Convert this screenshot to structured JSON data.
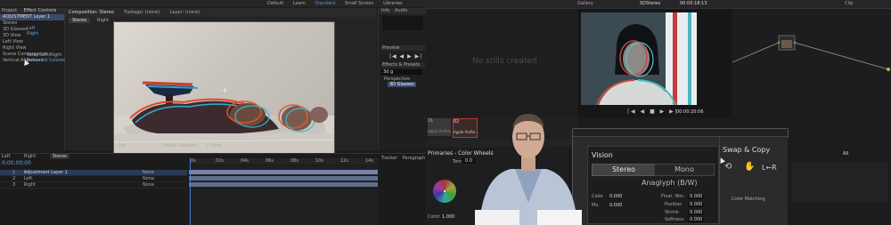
{
  "ae": {
    "menu": [
      "Default",
      "Learn",
      "Standard",
      "Small Screen",
      "Libraries"
    ],
    "project_tabs": [
      "Project",
      "Effect Controls"
    ],
    "project_items": [
      "ADJUSTMENT Layer 1",
      "Stereo",
      "Left",
      "Right",
      "Swap Left/Right",
      "3D View"
    ],
    "effect_items": [
      "3D Glasses",
      "3D View",
      "Left View",
      "Right View",
      "Scene Convergence",
      "Vertical Alignment"
    ],
    "effect_values": [
      "Left",
      "Right",
      "Swap Left/Right",
      "Balanced Colored R..."
    ],
    "viewer_tabs": [
      "Composition: Stereo",
      "Footage: (none)",
      "Layer: (none)"
    ],
    "viewer_subtabs": [
      "Stereo",
      "Right"
    ],
    "viewer_zoom": "Full",
    "viewer_camera": "Active Camera",
    "viewer_views": "1 View",
    "right_panel": {
      "info": "Info",
      "audio": "Audio",
      "preview": "Preview",
      "effects": "Effects & Presets",
      "search": "3d g",
      "category": "Perspective",
      "effect": "3D Glasses"
    },
    "timeline": {
      "tabs": [
        "Left",
        "Right",
        "Stereo"
      ],
      "timecode": "0;00;00;00",
      "layers": [
        {
          "num": "1",
          "name": "Adjustment Layer 1",
          "mode": "None"
        },
        {
          "num": "2",
          "name": "Left",
          "mode": "None"
        },
        {
          "num": "3",
          "name": "Right",
          "mode": "None"
        }
      ],
      "ruler": [
        "0s",
        "02s",
        "04s",
        "06s",
        "08s",
        "10s",
        "12s",
        "14s"
      ]
    },
    "bottom_right": [
      "Tracker",
      "Paragraph"
    ]
  },
  "dv": {
    "top": {
      "left": "Gallery",
      "clip_name": "SDStereo",
      "timecode": "00:00:18:13",
      "zoom": "Clip"
    },
    "gallery_text": "No stills created",
    "viewer_timecode": "00:00:20:06",
    "clips": [
      {
        "num": "01",
        "label": "Apple ProRes..."
      },
      {
        "num": "02",
        "label": "Apple ProRe..."
      }
    ],
    "primaries": {
      "title": "Primaries - Color Wheels",
      "temp_label": "Temp",
      "temp_value": "0.0",
      "tint_label": "Tint",
      "tint_value": "0.00",
      "contrast_label": "Contr",
      "contrast_value": "1.000"
    },
    "stereo": {
      "vision_label": "Vision",
      "stereo_btn": "Stereo",
      "mono_btn": "Mono",
      "output_value": "Anaglyph (B/W)",
      "swap_label": "Swap & Copy",
      "lr_label": "L←R"
    },
    "lower_fields": [
      {
        "label": "Float. Win.",
        "value": "0.000"
      },
      {
        "label": "Position",
        "value": "0.000"
      },
      {
        "label": "Shrink",
        "value": "0.000"
      },
      {
        "label": "Softness",
        "value": "0.000"
      },
      {
        "label": "Color",
        "value": "0.000"
      },
      {
        "label": "Mo",
        "value": "0.000"
      }
    ],
    "color_matching": "Color Matching",
    "right_label": "All"
  }
}
